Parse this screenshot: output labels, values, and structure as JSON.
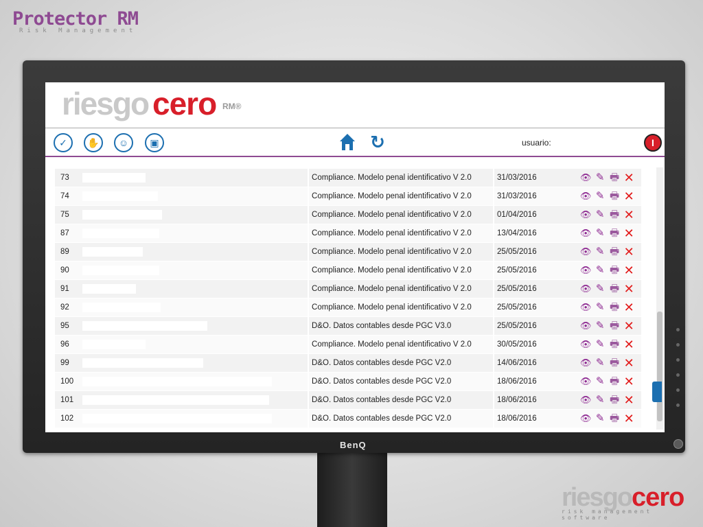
{
  "brand": {
    "name": "Protector RM",
    "tagline": "Risk Management"
  },
  "monitor": {
    "brand": "BenQ"
  },
  "app": {
    "logo_grey": "riesgo",
    "logo_red": "cero",
    "logo_suffix": "RM®"
  },
  "toolbar": {
    "user_label": "usuario:",
    "exit_label": "I"
  },
  "rows": [
    {
      "id": "73",
      "report": "Compliance. Modelo penal identificativo V 2.0",
      "date": "31/03/2016"
    },
    {
      "id": "74",
      "report": "Compliance. Modelo penal identificativo V 2.0",
      "date": "31/03/2016"
    },
    {
      "id": "75",
      "report": "Compliance. Modelo penal identificativo V 2.0",
      "date": "01/04/2016"
    },
    {
      "id": "87",
      "report": "Compliance. Modelo penal identificativo V 2.0",
      "date": "13/04/2016"
    },
    {
      "id": "89",
      "report": "Compliance. Modelo penal identificativo V 2.0",
      "date": "25/05/2016"
    },
    {
      "id": "90",
      "report": "Compliance. Modelo penal identificativo V 2.0",
      "date": "25/05/2016"
    },
    {
      "id": "91",
      "report": "Compliance. Modelo penal identificativo V 2.0",
      "date": "25/05/2016"
    },
    {
      "id": "92",
      "report": "Compliance. Modelo penal identificativo V 2.0",
      "date": "25/05/2016"
    },
    {
      "id": "95",
      "report": "D&O. Datos contables desde PGC V3.0",
      "date": "25/05/2016"
    },
    {
      "id": "96",
      "report": "Compliance. Modelo penal identificativo V 2.0",
      "date": "30/05/2016"
    },
    {
      "id": "99",
      "report": "D&O. Datos contables desde PGC V2.0",
      "date": "14/06/2016"
    },
    {
      "id": "100",
      "report": "D&O. Datos contables desde PGC V2.0",
      "date": "18/06/2016"
    },
    {
      "id": "101",
      "report": "D&O. Datos contables desde PGC V2.0",
      "date": "18/06/2016"
    },
    {
      "id": "102",
      "report": "D&O. Datos contables desde PGC V2.0",
      "date": "18/06/2016"
    }
  ],
  "icons": {
    "view": "eye-icon",
    "edit": "pencil-icon",
    "print": "printer-icon",
    "delete": "delete-x-icon"
  },
  "corner": {
    "logo_grey": "riesgo",
    "logo_red": "cero",
    "tagline": "risk management software"
  }
}
